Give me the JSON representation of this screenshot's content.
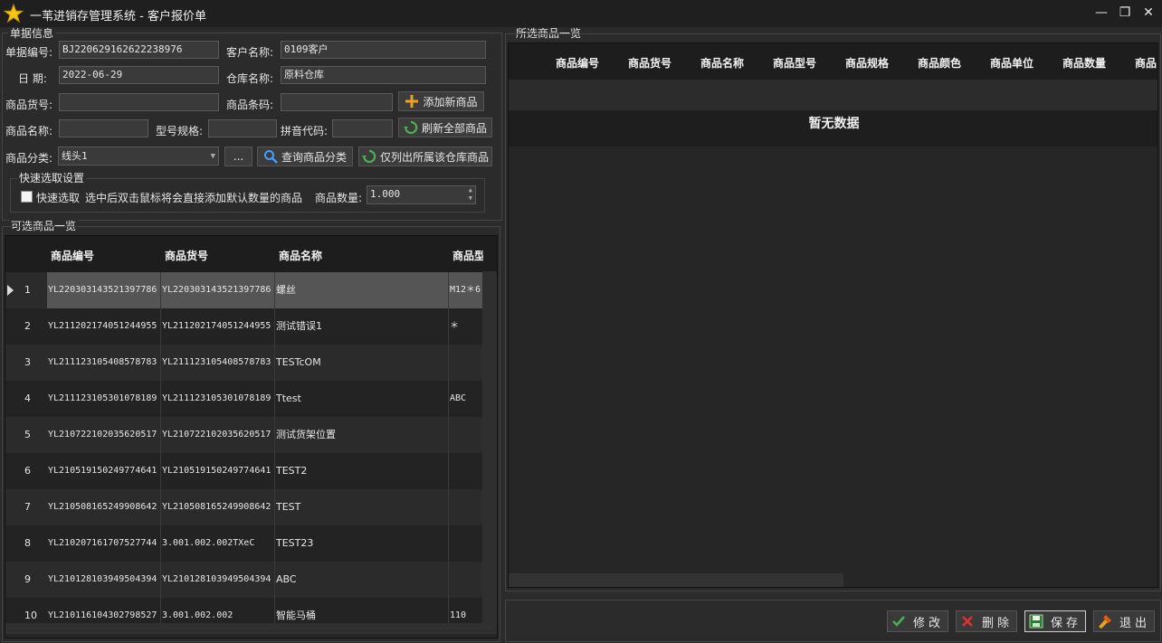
{
  "window": {
    "title": "一苇进销存管理系统 - 客户报价单",
    "controls": [
      "—",
      "❐",
      "✕"
    ]
  },
  "doc_info": {
    "group_title": "单据信息",
    "doc_no_label": "单据编号:",
    "doc_no_value": "BJ220629162622238976",
    "customer_label": "客户名称:",
    "customer_value": "0109客户",
    "date_label": "日  期:",
    "date_value": "2022-06-29",
    "warehouse_label": "仓库名称:",
    "warehouse_value": "原料仓库",
    "item_code_label": "商品货号:",
    "item_code_value": "",
    "barcode_label": "商品条码:",
    "barcode_value": "",
    "add_new_label": "添加新商品",
    "item_name_label": "商品名称:",
    "item_name_value": "",
    "model_label": "型号规格:",
    "model_value": "",
    "pinyin_label": "拼音代码:",
    "pinyin_value": "",
    "refresh_label": "刷新全部商品",
    "category_label": "商品分类:",
    "category_value": "线头1",
    "ellipsis_label": "...",
    "query_category_label": "查询商品分类",
    "warehouse_only_label": "仅列出所属该仓库商品"
  },
  "quick_select": {
    "group_title": "快速选取设置",
    "checkbox_label": "快速选取",
    "hint": "选中后双击鼠标将会直接添加默认数量的商品",
    "qty_label": "商品数量:",
    "qty_value": "1.000"
  },
  "available": {
    "group_title": "可选商品一览",
    "columns": [
      "商品编号",
      "商品货号",
      "商品名称",
      "商品型"
    ],
    "rows": [
      {
        "num": "1",
        "code": "YL220303143521397786",
        "sku": "YL220303143521397786",
        "name": "螺丝",
        "spec": "M12＊6"
      },
      {
        "num": "2",
        "code": "YL211202174051244955",
        "sku": "YL211202174051244955",
        "name": "测试错误1",
        "spec": "＊"
      },
      {
        "num": "3",
        "code": "YL211123105408578783",
        "sku": "YL211123105408578783",
        "name": "TESTcOM",
        "spec": ""
      },
      {
        "num": "4",
        "code": "YL211123105301078189",
        "sku": "YL211123105301078189",
        "name": "Ttest",
        "spec": "ABC"
      },
      {
        "num": "5",
        "code": "YL210722102035620517",
        "sku": "YL210722102035620517",
        "name": "测试货架位置",
        "spec": ""
      },
      {
        "num": "6",
        "code": "YL210519150249774641",
        "sku": "YL210519150249774641",
        "name": "TEST2",
        "spec": ""
      },
      {
        "num": "7",
        "code": "YL210508165249908642",
        "sku": "YL210508165249908642",
        "name": "TEST",
        "spec": ""
      },
      {
        "num": "8",
        "code": "YL210207161707527744",
        "sku": "3.001.002.002TXeC",
        "name": "TEST23",
        "spec": ""
      },
      {
        "num": "9",
        "code": "YL210128103949504394",
        "sku": "YL210128103949504394",
        "name": "ABC",
        "spec": ""
      },
      {
        "num": "10",
        "code": "YL210116104302798527",
        "sku": "3.001.002.002",
        "name": "智能马桶",
        "spec": "110"
      }
    ]
  },
  "selected": {
    "group_title": "所选商品一览",
    "columns": [
      "商品编号",
      "商品货号",
      "商品名称",
      "商品型号",
      "商品规格",
      "商品颜色",
      "商品单位",
      "商品数量",
      "商品"
    ],
    "empty_text": "暂无数据"
  },
  "actions": {
    "edit": "修改",
    "delete": "删除",
    "save": "保存",
    "exit": "退出"
  },
  "colors": {
    "background": "#2b2b2b",
    "selected_row": "#555555",
    "accent_green": "#4caf50",
    "accent_orange": "#f0a020",
    "accent_red": "#e03030"
  }
}
